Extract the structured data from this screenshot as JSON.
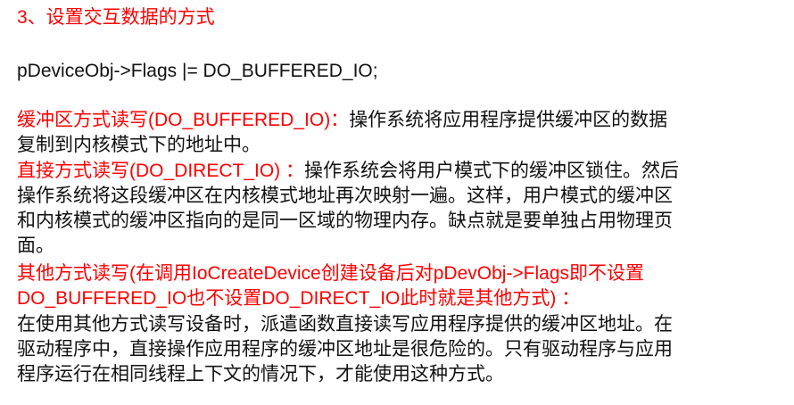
{
  "colors": {
    "heading": "#ff0000",
    "body": "#111111"
  },
  "title": "3、设置交互数据的方式",
  "code": "pDeviceObj->Flags |= DO_BUFFERED_IO;",
  "buffered": {
    "label": "缓冲区方式读写(DO_BUFFERED_IO)：",
    "line1": "操作系统将应用程序提供缓冲区的数据",
    "line2": "复制到内核模式下的地址中。"
  },
  "direct": {
    "label": "直接方式读写(DO_DIRECT_IO) ：",
    "line1": "操作系统会将用户模式下的缓冲区锁住。然后",
    "line2": "操作系统将这段缓冲区在内核模式地址再次映射一遍。这样，用户模式的缓冲区",
    "line3": "和内核模式的缓冲区指向的是同一区域的物理内存。缺点就是要单独占用物理页",
    "line4": "面。"
  },
  "other": {
    "label1": "其他方式读写(在调用IoCreateDevice创建设备后对pDevObj->Flags即不设置",
    "label2": "DO_BUFFERED_IO也不设置DO_DIRECT_IO此时就是其他方式) ：",
    "line1": "在使用其他方式读写设备时，派遣函数直接读写应用程序提供的缓冲区地址。在",
    "line2": "驱动程序中，直接操作应用程序的缓冲区地址是很危险的。只有驱动程序与应用",
    "line3": "程序运行在相同线程上下文的情况下，才能使用这种方式。"
  }
}
